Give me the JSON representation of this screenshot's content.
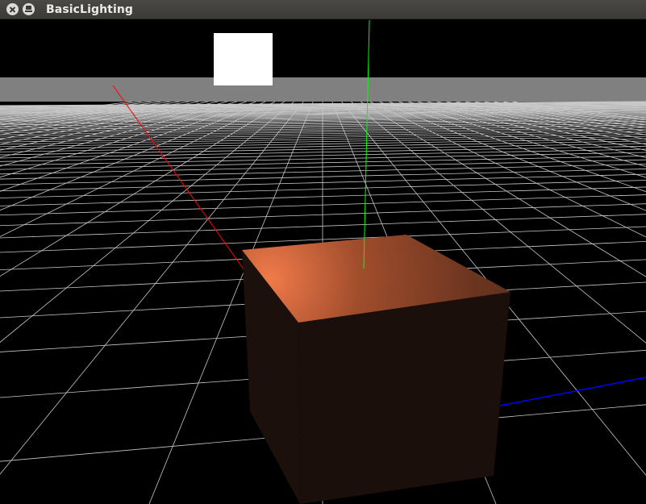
{
  "window": {
    "title": "BasicLighting",
    "buttons": {
      "close": "close-icon",
      "minimize": "minimize-icon"
    }
  },
  "scene": {
    "background_color": "#000000",
    "horizon_color": "#808080",
    "grid_color": "#c8c8c8",
    "axes": {
      "x": "#ff0000",
      "y": "#00ff00",
      "z": "#0000ff"
    },
    "light_color": "#ffffff",
    "cube": {
      "top_lit_color": "#f07a4a",
      "top_dark_color": "#6a3420",
      "side_color": "#1a0f0a"
    }
  }
}
